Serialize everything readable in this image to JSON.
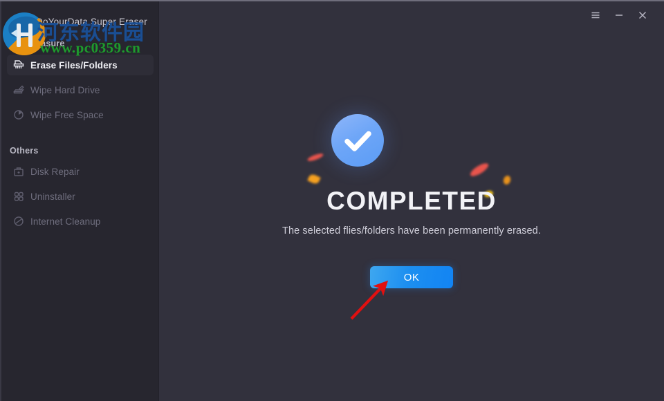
{
  "window": {
    "title": "DoYourData Super Eraser",
    "controls": [
      {
        "name": "menu",
        "icon": "hamburger-menu-icon",
        "label": "☰"
      },
      {
        "name": "minimize",
        "icon": "minimize-icon",
        "label": "—"
      },
      {
        "name": "close",
        "icon": "close-icon",
        "label": "✕"
      }
    ]
  },
  "watermark": {
    "site_name_cn": "河东软件园",
    "site_url": "www.pc0359.cn",
    "logo_icon": "site-logo-icon"
  },
  "sidebar": {
    "groups": [
      {
        "label": "Data Erasure",
        "items": [
          {
            "label": "Erase Files/Folders",
            "icon": "shredder-icon",
            "active": true
          },
          {
            "label": "Wipe Hard Drive",
            "icon": "hard-drive-wipe-icon",
            "active": false
          },
          {
            "label": "Wipe Free Space",
            "icon": "pie-chart-icon",
            "active": false
          }
        ]
      },
      {
        "label": "Others",
        "items": [
          {
            "label": "Disk Repair",
            "icon": "toolbox-icon",
            "active": false
          },
          {
            "label": "Uninstaller",
            "icon": "grid-squares-icon",
            "active": false
          },
          {
            "label": "Internet Cleanup",
            "icon": "globe-slash-icon",
            "active": false
          }
        ]
      }
    ]
  },
  "main": {
    "status_icon": "checkmark-circle-icon",
    "heading": "COMPLETED",
    "subtitle": "The selected flies/folders have been permanently erased.",
    "ok_label": "OK"
  },
  "annotation": {
    "type": "arrow",
    "color": "#e01010",
    "points_to": "ok-button"
  },
  "colors": {
    "sidebar_bg": "#27262f",
    "main_bg": "#32313d",
    "active_item_bg": "#2e2d37",
    "accent_blue": "#1d8ff0",
    "check_circle": "#6ea6f7",
    "text_primary": "#eeeef3",
    "text_muted": "#6f6e7e",
    "watermark_blue": "#1a4e93",
    "watermark_green": "#1f9a2e"
  }
}
